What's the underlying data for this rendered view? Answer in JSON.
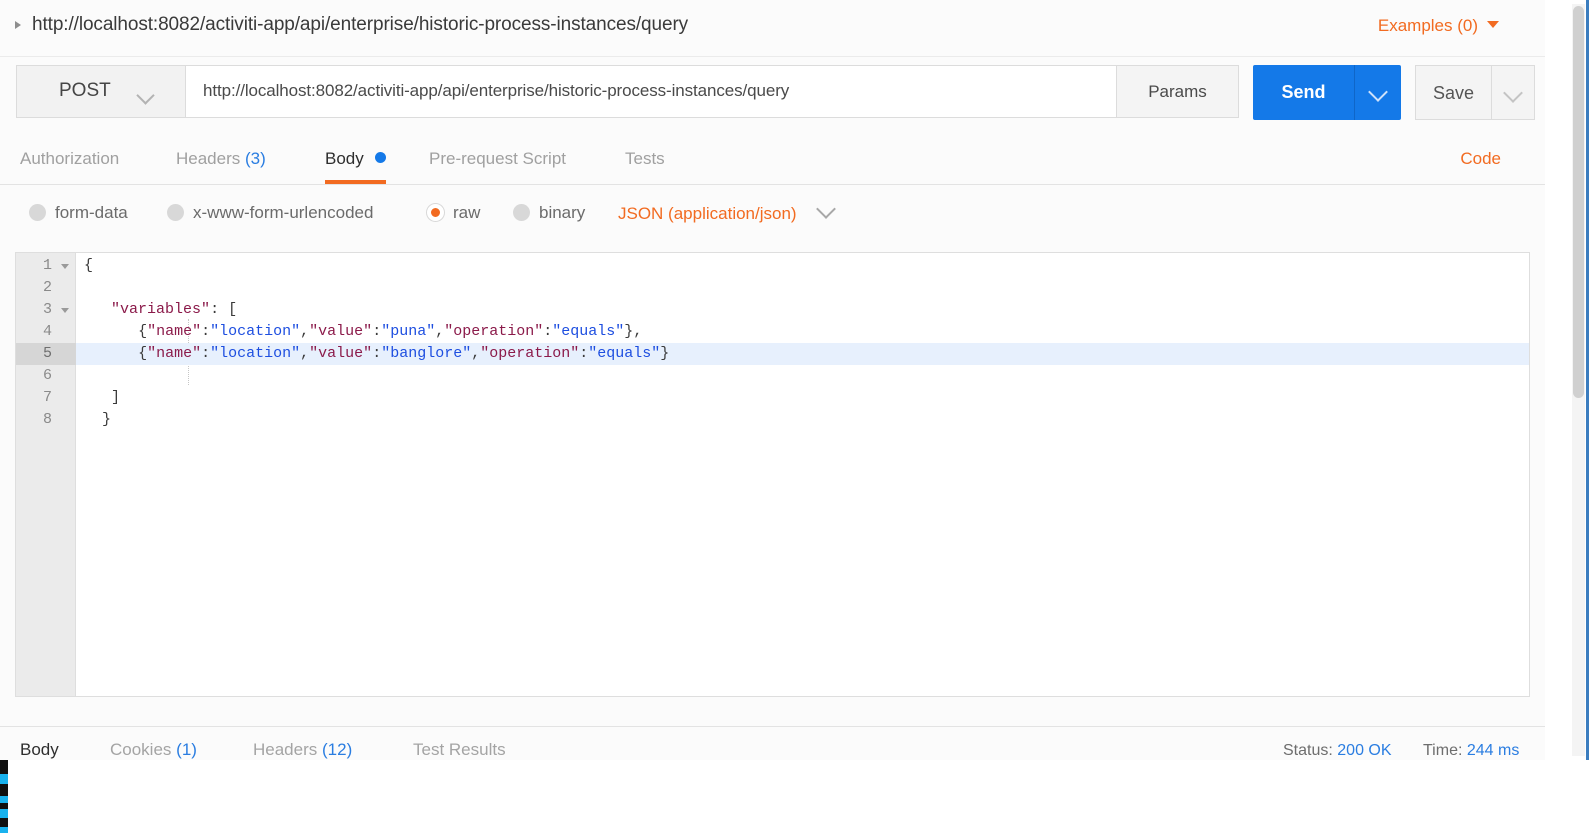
{
  "window": {
    "title_url": "http://localhost:8082/activiti-app/api/enterprise/historic-process-instances/query",
    "examples_label": "Examples (0)"
  },
  "request": {
    "method": "POST",
    "url": "http://localhost:8082/activiti-app/api/enterprise/historic-process-instances/query",
    "params_label": "Params",
    "send_label": "Send",
    "save_label": "Save",
    "code_link": "Code",
    "tabs": [
      {
        "label": "Authorization",
        "count": "",
        "active": false,
        "dot": false
      },
      {
        "label": "Headers",
        "count": "(3)",
        "active": false,
        "dot": false
      },
      {
        "label": "Body",
        "count": "",
        "active": true,
        "dot": true
      },
      {
        "label": "Pre-request Script",
        "count": "",
        "active": false,
        "dot": false
      },
      {
        "label": "Tests",
        "count": "",
        "active": false,
        "dot": false
      }
    ],
    "body_types": [
      {
        "label": "form-data",
        "selected": false
      },
      {
        "label": "x-www-form-urlencoded",
        "selected": false
      },
      {
        "label": "raw",
        "selected": true
      },
      {
        "label": "binary",
        "selected": false
      }
    ],
    "content_type": "JSON (application/json)"
  },
  "editor": {
    "active_line": 5,
    "lines": [
      {
        "n": "1",
        "fold": true,
        "text": "{"
      },
      {
        "n": "2",
        "fold": false,
        "text": ""
      },
      {
        "n": "3",
        "fold": true,
        "text": "   \"variables\": ["
      },
      {
        "n": "4",
        "fold": false,
        "text": "      {\"name\":\"location\",\"value\":\"puna\",\"operation\":\"equals\"},"
      },
      {
        "n": "5",
        "fold": false,
        "text": "      {\"name\":\"location\",\"value\":\"banglore\",\"operation\":\"equals\"}"
      },
      {
        "n": "6",
        "fold": false,
        "text": ""
      },
      {
        "n": "7",
        "fold": false,
        "text": "   ]"
      },
      {
        "n": "8",
        "fold": false,
        "text": "  }"
      }
    ]
  },
  "response": {
    "tabs": [
      {
        "label": "Body",
        "count": "",
        "active": true
      },
      {
        "label": "Cookies",
        "count": "(1)",
        "active": false
      },
      {
        "label": "Headers",
        "count": "(12)",
        "active": false
      },
      {
        "label": "Test Results",
        "count": "",
        "active": false
      }
    ],
    "status_label": "Status:",
    "status_value": "200 OK",
    "time_label": "Time:",
    "time_value": "244 ms"
  },
  "colors": {
    "accent_orange": "#f26b21",
    "send_blue": "#1479e8",
    "link_blue": "#2a7de1",
    "json_key": "#8b1a4a",
    "json_string": "#1d4ee0",
    "active_line_bg": "#e7f0fd"
  }
}
